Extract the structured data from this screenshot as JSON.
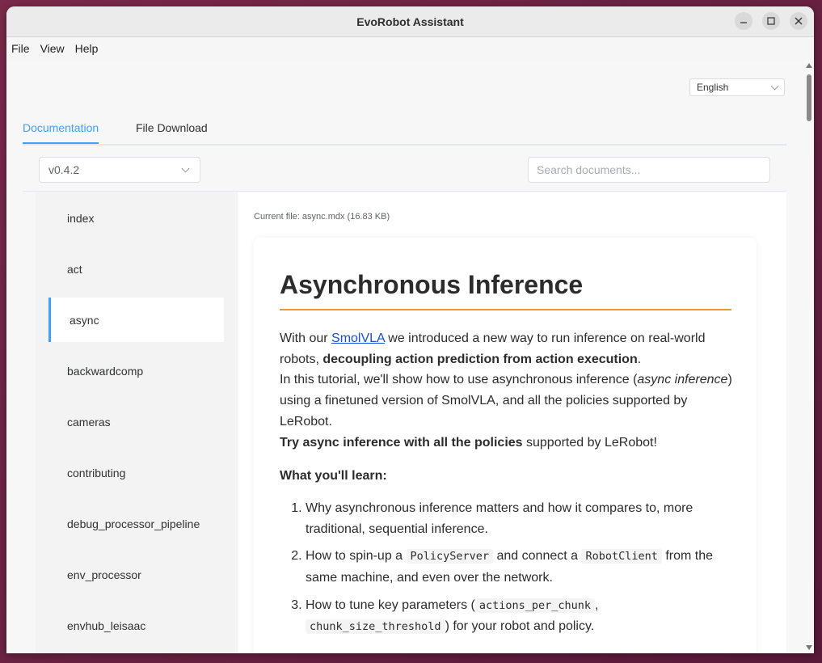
{
  "window": {
    "title": "EvoRobot Assistant"
  },
  "menu": {
    "file": "File",
    "view": "View",
    "help": "Help"
  },
  "language": {
    "selected": "English"
  },
  "tabs": [
    {
      "label": "Documentation"
    },
    {
      "label": "File Download"
    }
  ],
  "version": {
    "selected": "v0.4.2"
  },
  "search": {
    "placeholder": "Search documents..."
  },
  "sidebar": {
    "items": [
      {
        "label": "index"
      },
      {
        "label": "act"
      },
      {
        "label": "async"
      },
      {
        "label": "backwardcomp"
      },
      {
        "label": "cameras"
      },
      {
        "label": "contributing"
      },
      {
        "label": "debug_processor_pipeline"
      },
      {
        "label": "env_processor"
      },
      {
        "label": "envhub_leisaac"
      }
    ],
    "active_index": 2
  },
  "doc": {
    "current_file": "Current file: async.mdx (16.83 KB)",
    "title": "Asynchronous Inference",
    "p1_a": "With our ",
    "p1_link": "SmolVLA",
    "p1_b": " we introduced a new way to run inference on real-world robots, ",
    "p1_bold": "decoupling action prediction from action execution",
    "p1_c": ".",
    "p2_a": "In this tutorial, we'll show how to use asynchronous inference (",
    "p2_italic": "async inference",
    "p2_b": ") using a finetuned version of SmolVLA, and all the policies supported by LeRobot.",
    "p3_bold": "Try async inference with all the policies",
    "p3_b": " supported by LeRobot!",
    "learn_heading": "What you'll learn:",
    "li1": "Why asynchronous inference matters and how it compares to, more traditional, sequential inference.",
    "li2_a": "How to spin-up a ",
    "li2_code1": "PolicyServer",
    "li2_b": " and connect a ",
    "li2_code2": "RobotClient",
    "li2_c": " from the same machine, and even over the network.",
    "li3_a": "How to tune key parameters (",
    "li3_code1": "actions_per_chunk",
    "li3_b": ", ",
    "li3_code2": "chunk_size_threshold",
    "li3_c": ") for your robot and policy."
  }
}
